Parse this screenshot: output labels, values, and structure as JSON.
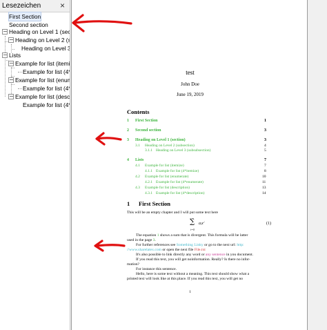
{
  "sidebar": {
    "title": "Lesezeichen",
    "close_icon": "×",
    "items": [
      {
        "label": "First Section"
      },
      {
        "label": "Second section"
      },
      {
        "label": "Heading on Level 1 (sectio"
      },
      {
        "label": "Heading on Level 2 (su"
      },
      {
        "label": "Heading on Level 3"
      },
      {
        "label": "Lists"
      },
      {
        "label": "Example for list (itemi"
      },
      {
        "label": "Example for list (4*"
      },
      {
        "label": "Example for list (enum"
      },
      {
        "label": "Example for list (4*"
      },
      {
        "label": "Example for list (descr"
      },
      {
        "label": "Example for list (4*"
      }
    ]
  },
  "document": {
    "title": "test",
    "author": "John Doe",
    "date": "June 19, 2019",
    "contents_heading": "Contents",
    "toc": [
      {
        "num": "1",
        "label": "First Section",
        "page": "1"
      },
      {
        "num": "2",
        "label": "Second section",
        "page": "3"
      },
      {
        "num": "3",
        "label": "Heading on Level 1 (section)",
        "page": "3"
      },
      {
        "num": "3.1",
        "label": "Heading on Level 2 (subsection)",
        "page": "4"
      },
      {
        "num": "3.1.1",
        "label": "Heading on Level 3 (subsubsection)",
        "page": "5"
      },
      {
        "num": "4",
        "label": "Lists",
        "page": "7"
      },
      {
        "num": "4.1",
        "label": "Example for list (itemize)",
        "page": "7"
      },
      {
        "num": "4.1.1",
        "label": "Example for list (4*itemize)",
        "page": "8"
      },
      {
        "num": "4.2",
        "label": "Example for list (enumerate)",
        "page": "10"
      },
      {
        "num": "4.2.1",
        "label": "Example for list (4*enumerate)",
        "page": "11"
      },
      {
        "num": "4.3",
        "label": "Example for list (description)",
        "page": "13"
      },
      {
        "num": "4.3.1",
        "label": "Example for list (4*description)",
        "page": "14"
      }
    ],
    "section_num": "1",
    "section_title": "First Section",
    "intro": "This will be an empty chapter and I will put some text here",
    "equation_sum": "∑",
    "equation_top": "∞",
    "equation_bottom": "i=0",
    "equation_body": "aᵢxⁱ",
    "equation_label": "(1)",
    "paragraphs": {
      "p1a_pre": "The equation ",
      "p1a_ref": "1",
      "p1a_post": " shows a sum that is divergent. This formula will be latter",
      "p1b_pre": "used in the page ",
      "p1b_ref": "3",
      "p1b_post": ".",
      "p2a_pre": "For further references see ",
      "p2a_link1": "Something Linky",
      "p2a_mid": " or go to the next url: ",
      "p2a_link2": "http:",
      "p2b_link": "//www.sharelatex.com",
      "p2b_mid": " or open the next file ",
      "p2b_file": "File.txt",
      "p3a_pre": "It's also possible to link directly any word or ",
      "p3a_link": "any sentence",
      "p3a_post": " in you document.",
      "p3b": "If you read this text, you will get noinformation. Really? Is there no infor-",
      "p3c": "mation?",
      "p4": "For instance this sentence.",
      "p5a": "Hello, here is some text without a meaning. This text should show what a",
      "p5b": "printed text will look like at this place. If you read this text, you will get no"
    },
    "page_number": "1"
  },
  "colors": {
    "link_green": "#3cb43c",
    "link_cyan": "#3cb4c8",
    "link_magenta": "#c83c96",
    "link_red": "#d23232",
    "annotation_red": "#e01010"
  }
}
